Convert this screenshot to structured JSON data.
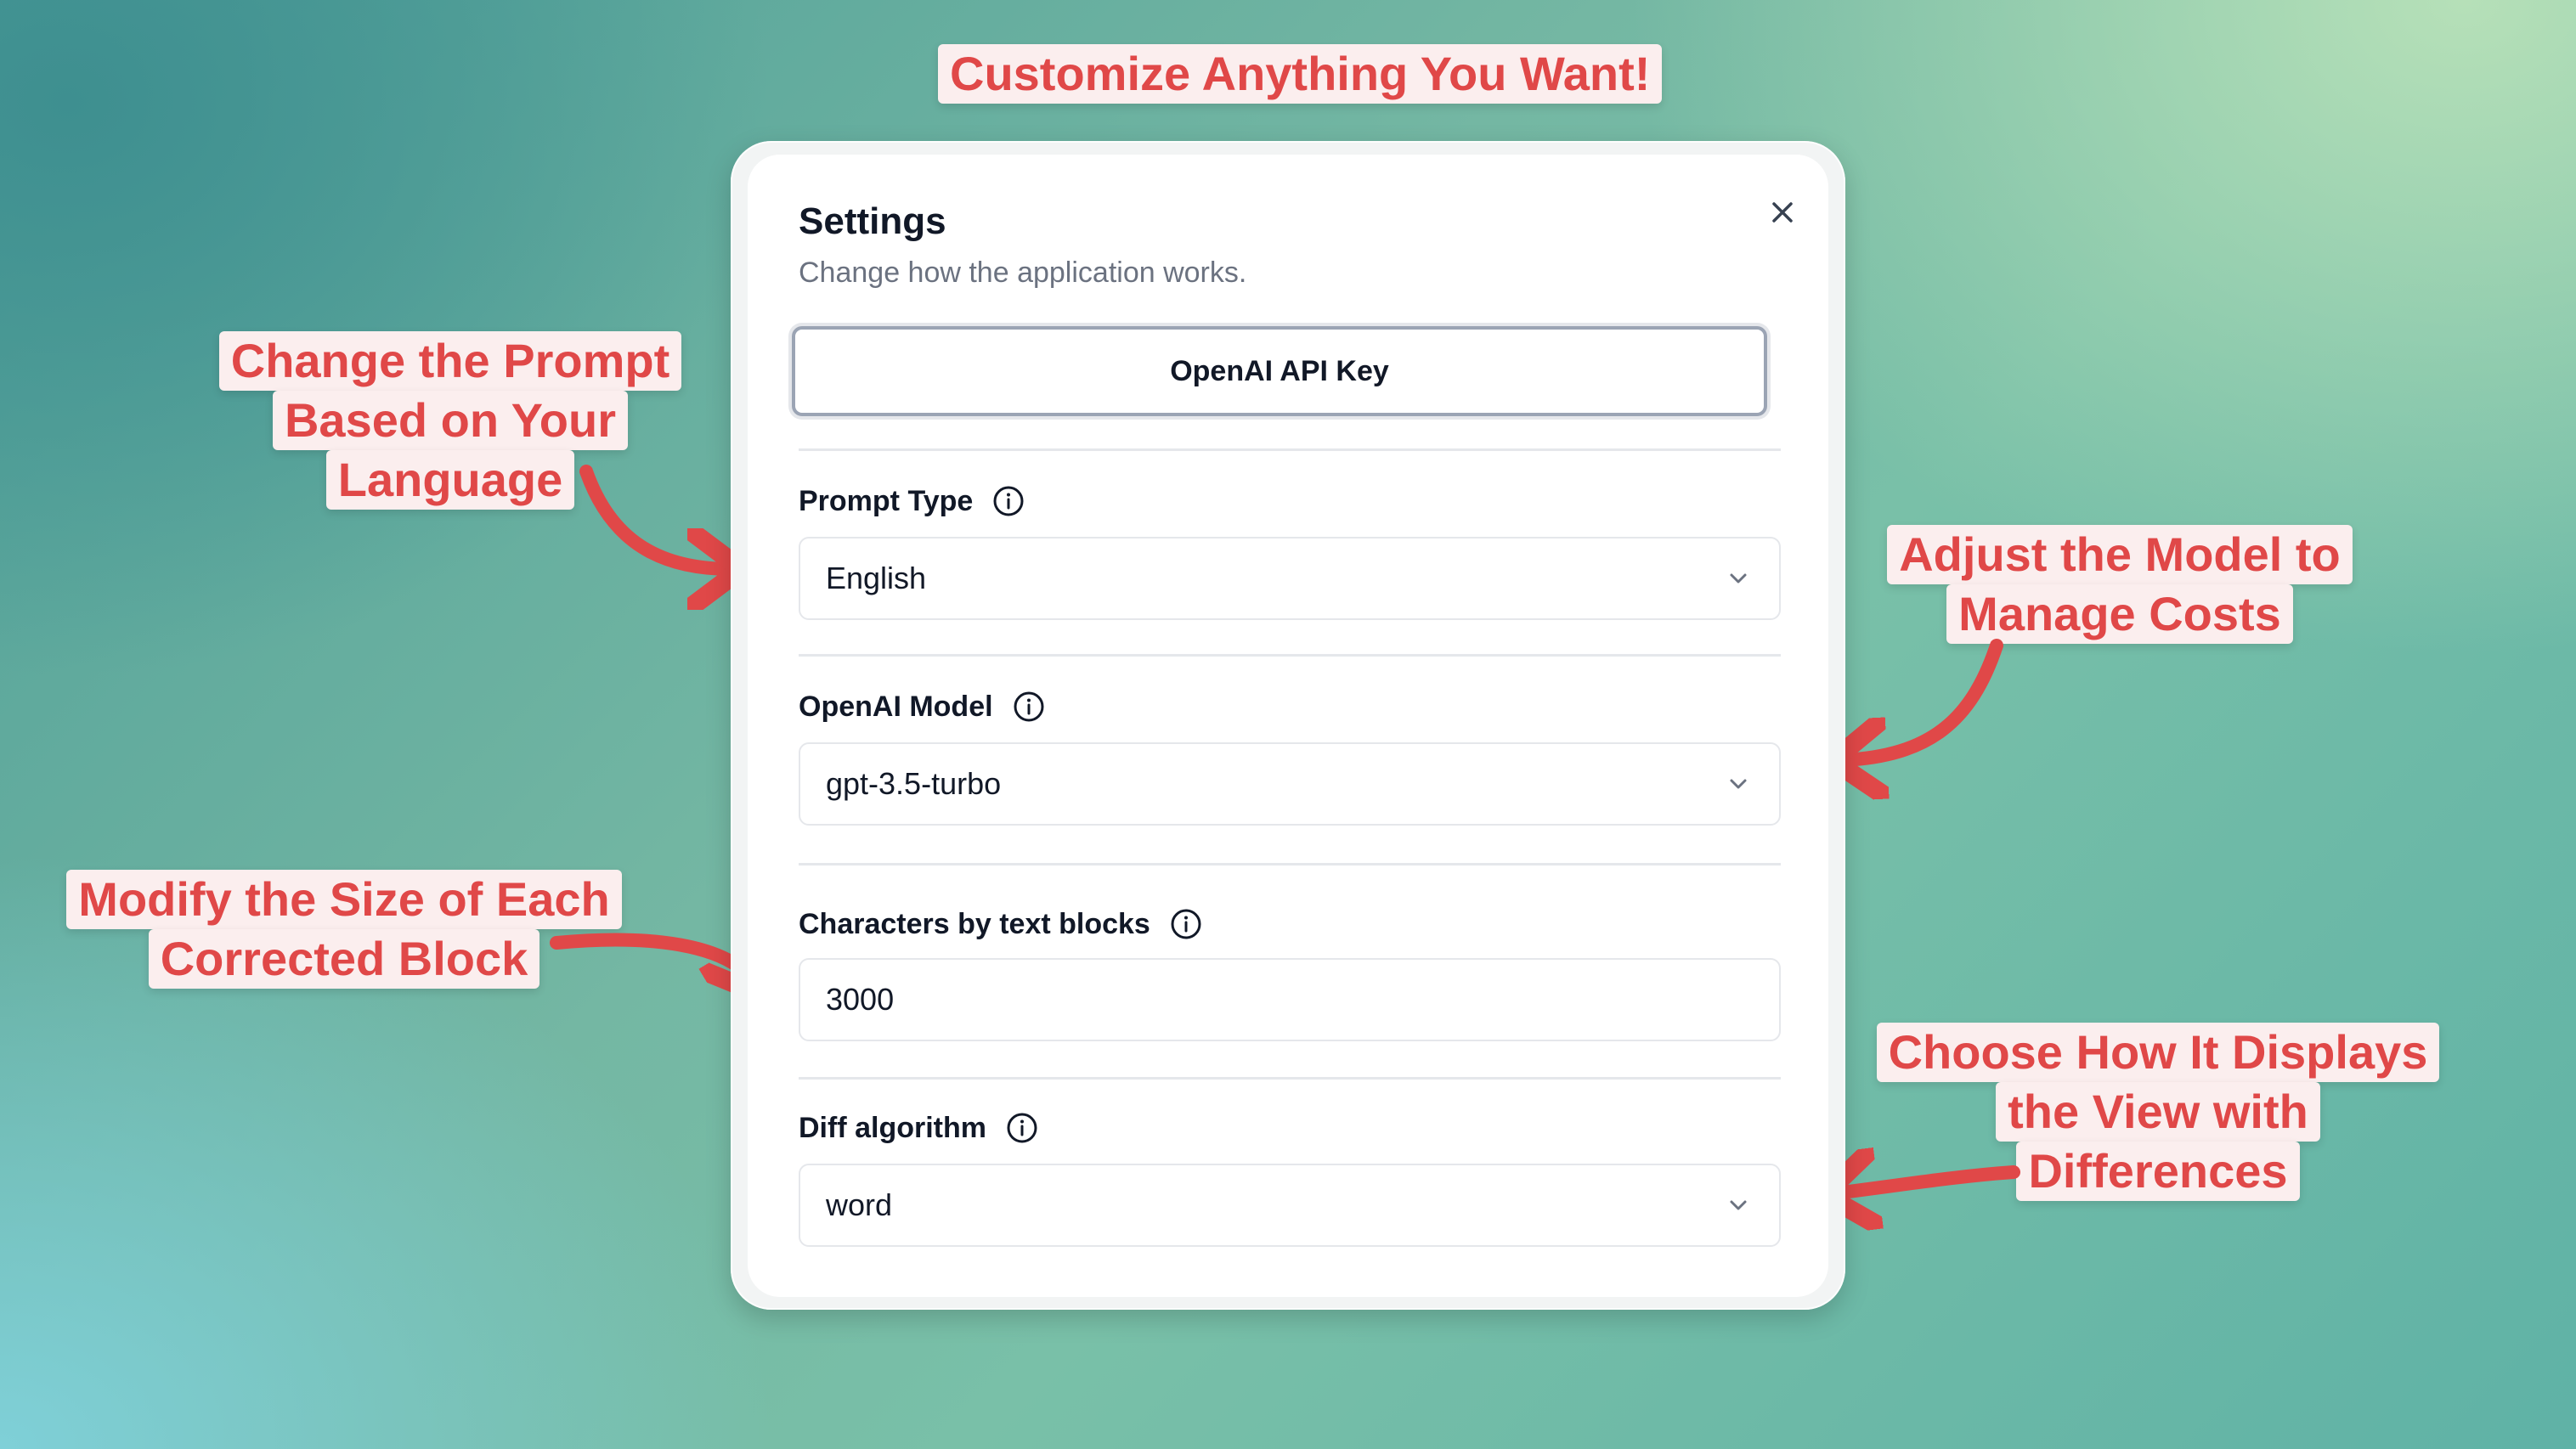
{
  "annotations": {
    "top": "Customize Anything You Want!",
    "prompt": [
      "Change the Prompt",
      "Based on Your",
      "Language"
    ],
    "model": [
      "Adjust the Model to",
      "Manage Costs"
    ],
    "block": [
      "Modify the Size of Each",
      "Corrected Block"
    ],
    "diff": [
      "Choose How It Displays",
      "the View with",
      "Differences"
    ]
  },
  "dialog": {
    "title": "Settings",
    "subtitle": "Change how the application works.",
    "api_key_button": "OpenAI API Key",
    "prompt_type": {
      "label": "Prompt Type",
      "value": "English"
    },
    "model": {
      "label": "OpenAI Model",
      "value": "gpt-3.5-turbo"
    },
    "chars": {
      "label": "Characters by text blocks",
      "value": "3000"
    },
    "diff": {
      "label": "Diff algorithm",
      "value": "word"
    }
  },
  "colors": {
    "annotation_text": "#e04848",
    "annotation_bg": "#fbeeee",
    "arrow": "#e04848"
  },
  "icons": [
    "close-icon",
    "info-icon",
    "chevron-down-icon",
    "arrow-icon"
  ]
}
